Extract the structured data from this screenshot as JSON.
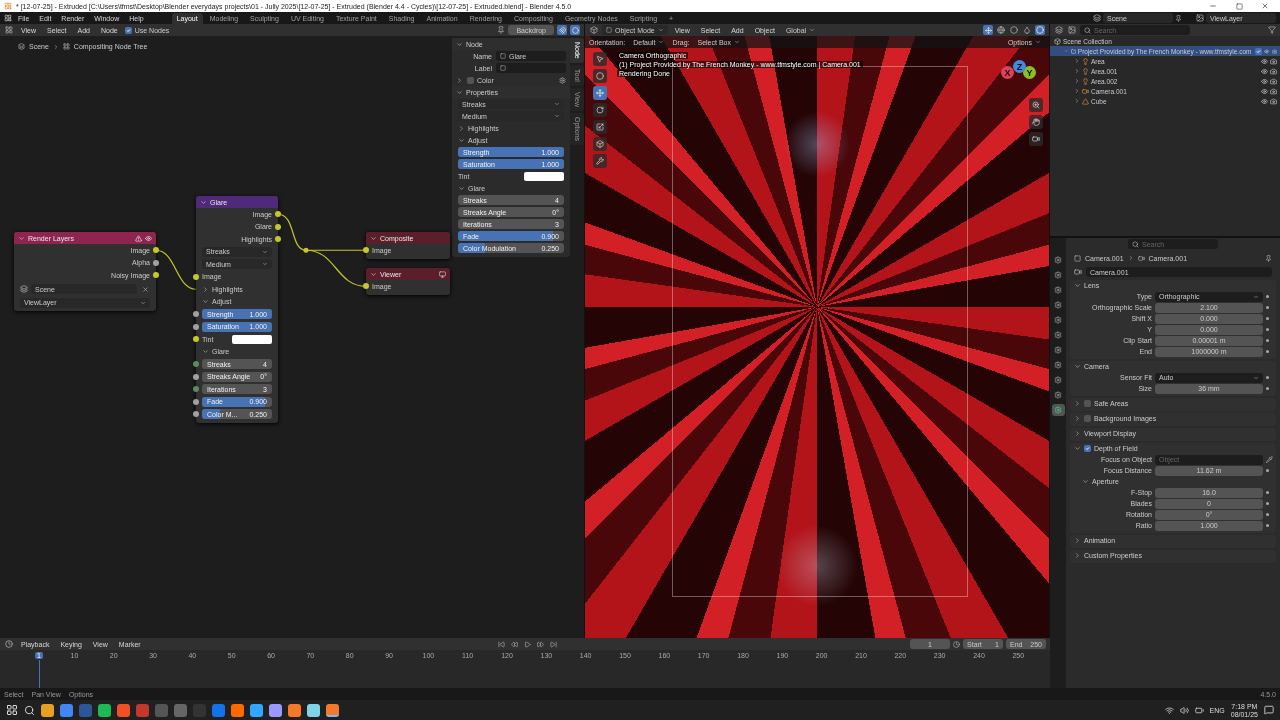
{
  "title_bar": {
    "title": "* [12-07-25] - Extruded [C:\\Users\\tfmst\\Desktop\\Blender everydays projects\\01 - Jully 2025\\[12-07-25] - Extruded (Blender 4.4 - Cycles)\\[12-07-25] - Extruded.blend] - Blender 4.5.0"
  },
  "menu_bar": {
    "menus": [
      "File",
      "Edit",
      "Render",
      "Window",
      "Help"
    ],
    "workspaces": [
      {
        "label": "Layout",
        "selected": true
      },
      {
        "label": "Modeling",
        "selected": false
      },
      {
        "label": "Sculpting",
        "selected": false
      },
      {
        "label": "UV Editing",
        "selected": false
      },
      {
        "label": "Texture Paint",
        "selected": false
      },
      {
        "label": "Shading",
        "selected": false
      },
      {
        "label": "Animation",
        "selected": false
      },
      {
        "label": "Rendering",
        "selected": false
      },
      {
        "label": "Compositing",
        "selected": false
      },
      {
        "label": "Geometry Nodes",
        "selected": false
      },
      {
        "label": "Scripting",
        "selected": false
      }
    ],
    "add_workspace": "+",
    "scene": "Scene",
    "view_layer": "ViewLayer"
  },
  "node_editor": {
    "menus": [
      "View",
      "Select",
      "Add",
      "Node"
    ],
    "use_nodes": {
      "label": "Use Nodes",
      "checked": true
    },
    "backdrop": "Backdrop",
    "breadcrumb": [
      "Scene",
      "Compositing Node Tree"
    ],
    "nodes": [
      {
        "kind": "input",
        "title": "Render Layers",
        "rows": [
          {
            "kind": "output",
            "label": "Image",
            "color": "#c7c729"
          },
          {
            "kind": "output",
            "label": "Alpha",
            "color": "#a1a1a1"
          },
          {
            "kind": "output",
            "label": "Noisy Image",
            "color": "#c7c729"
          },
          {
            "kind": "scene",
            "value": "Scene"
          },
          {
            "kind": "dropdown",
            "value": "ViewLayer"
          }
        ]
      },
      {
        "kind": "filter",
        "title": "Glare",
        "rows": [
          {
            "kind": "output",
            "label": "Image",
            "color": "#c7c729"
          },
          {
            "kind": "output",
            "label": "Glare",
            "color": "#c7c729"
          },
          {
            "kind": "output",
            "label": "Highlights",
            "color": "#c7c729"
          },
          {
            "kind": "dropdown",
            "value": "Streaks"
          },
          {
            "kind": "dropdown",
            "value": "Medium"
          },
          {
            "kind": "input",
            "label": "Image",
            "color": "#c7c729"
          },
          {
            "kind": "panel",
            "label": "Highlights",
            "expanded": false
          },
          {
            "kind": "panel",
            "label": "Adjust",
            "expanded": true
          },
          {
            "kind": "slider",
            "label": "Strength",
            "value": "1.000",
            "level": 1,
            "color": "#a1a1a1"
          },
          {
            "kind": "slider",
            "label": "Saturation",
            "value": "1.000",
            "level": 1,
            "color": "#a1a1a1"
          },
          {
            "kind": "color",
            "label": "Tint",
            "color": "#c7c729"
          },
          {
            "kind": "panel",
            "label": "Glare",
            "expanded": true
          },
          {
            "kind": "number",
            "label": "Streaks",
            "value": "4",
            "color": "#598c5c"
          },
          {
            "kind": "number",
            "label": "Streaks Angle",
            "value": "0°",
            "color": "#a1a1a1"
          },
          {
            "kind": "number",
            "label": "Iterations",
            "value": "3",
            "color": "#598c5c"
          },
          {
            "kind": "slider",
            "label": "Fade",
            "value": "0.900",
            "level": 0.9,
            "color": "#a1a1a1"
          },
          {
            "kind": "slider",
            "label": "Color M...",
            "value": "0.250",
            "level": 0.25,
            "color": "#a1a1a1"
          }
        ]
      },
      {
        "kind": "output",
        "title": "Composite",
        "rows": [
          {
            "kind": "input",
            "label": "Image",
            "color": "#c7c729"
          }
        ]
      },
      {
        "kind": "viewer",
        "title": "Viewer",
        "rows": [
          {
            "kind": "input",
            "label": "Image",
            "color": "#c7c729"
          }
        ]
      }
    ],
    "sidebar": {
      "tabs": [
        {
          "label": "Node",
          "selected": true
        },
        {
          "label": "Tool",
          "selected": false
        },
        {
          "label": "View",
          "selected": false
        },
        {
          "label": "Options",
          "selected": false
        }
      ],
      "node_panel": {
        "title": "Node",
        "name_label": "Name",
        "name": "Glare",
        "label_label": "Label",
        "color_label": "Color",
        "color_checked": false
      },
      "properties_panel": {
        "title": "Properties",
        "rows": [
          {
            "kind": "dropdown",
            "value": "Streaks"
          },
          {
            "kind": "dropdown",
            "value": "Medium"
          },
          {
            "kind": "panel",
            "label": "Highlights",
            "expanded": false
          },
          {
            "kind": "panel",
            "label": "Adjust",
            "expanded": true
          },
          {
            "kind": "slider",
            "label": "Strength",
            "value": "1.000",
            "level": 1
          },
          {
            "kind": "slider",
            "label": "Saturation",
            "value": "1.000",
            "level": 1
          },
          {
            "kind": "color",
            "label": "Tint"
          },
          {
            "kind": "panel",
            "label": "Glare",
            "expanded": true
          },
          {
            "kind": "number",
            "label": "Streaks",
            "value": "4"
          },
          {
            "kind": "number",
            "label": "Streaks Angle",
            "value": "0°"
          },
          {
            "kind": "number",
            "label": "Iterations",
            "value": "3"
          },
          {
            "kind": "slider",
            "label": "Fade",
            "value": "0.900",
            "level": 0.9
          },
          {
            "kind": "slider",
            "label": "Color Modulation",
            "value": "0.250",
            "level": 0.25
          }
        ]
      }
    }
  },
  "viewport": {
    "mode": "Object Mode",
    "menus": [
      "View",
      "Select",
      "Add",
      "Object"
    ],
    "transform": "Global",
    "orientation_label": "Orientation:",
    "orientation": "Default",
    "drag_label": "Drag:",
    "drag": "Select Box",
    "options": "Options",
    "overlay_lines": [
      "Camera Orthographic",
      "(1) Project Provided by The French Monkey - www.tfmstyle.com | Camera.001",
      "Rendering Done"
    ],
    "gizmo": [
      {
        "label": "X",
        "color": "#e0405a"
      },
      {
        "label": "Y",
        "color": "#8bbf26"
      },
      {
        "label": "Z",
        "color": "#3f8be0"
      }
    ]
  },
  "outliner": {
    "search_placeholder": "Search",
    "tree": [
      {
        "label": "Scene Collection",
        "kind": "scene",
        "selected": false,
        "children": [
          {
            "label": "Project Provided by The French Monkey - www.tfmstyle.com",
            "kind": "collection",
            "expanded": true,
            "selected": true,
            "children": [
              {
                "label": "Area",
                "kind": "light",
                "expanded": false,
                "selected": false
              },
              {
                "label": "Area.001",
                "kind": "light",
                "expanded": false,
                "selected": false
              },
              {
                "label": "Area.002",
                "kind": "light",
                "expanded": false,
                "selected": false
              },
              {
                "label": "Camera.001",
                "kind": "camera",
                "expanded": false,
                "selected": false
              },
              {
                "label": "Cube",
                "kind": "mesh",
                "expanded": false,
                "selected": false
              }
            ]
          }
        ]
      }
    ]
  },
  "properties": {
    "search_placeholder": "Search",
    "tabs": [
      {
        "selected": false
      },
      {
        "selected": false
      },
      {
        "selected": false
      },
      {
        "selected": false
      },
      {
        "selected": false
      },
      {
        "selected": false
      },
      {
        "selected": false
      },
      {
        "selected": false
      },
      {
        "selected": false
      },
      {
        "selected": false
      },
      {
        "selected": true
      }
    ],
    "breadcrumb": [
      "Camera.001",
      "Camera.001"
    ],
    "data_name": "Camera.001",
    "panels": [
      {
        "title": "Lens",
        "expanded": true,
        "rows": [
          {
            "kind": "dropdown",
            "label": "Type",
            "value": "Orthographic"
          },
          {
            "kind": "number",
            "label": "Orthographic Scale",
            "value": "2.100"
          },
          {
            "kind": "number",
            "label": "Shift X",
            "value": "0.000"
          },
          {
            "kind": "number",
            "label": "Y",
            "value": "0.000"
          },
          {
            "kind": "number",
            "label": "Clip Start",
            "value": "0.00001 m"
          },
          {
            "kind": "number",
            "label": "End",
            "value": "1000000 m"
          }
        ]
      },
      {
        "title": "Camera",
        "expanded": true,
        "rows": [
          {
            "kind": "dropdown",
            "label": "Sensor Fit",
            "value": "Auto"
          },
          {
            "kind": "number",
            "label": "Size",
            "value": "36 mm"
          }
        ]
      },
      {
        "title": "Safe Areas",
        "expanded": false,
        "checkbox": false
      },
      {
        "title": "Background Images",
        "expanded": false,
        "checkbox": false
      },
      {
        "title": "Viewport Display",
        "expanded": false
      },
      {
        "title": "Depth of Field",
        "expanded": true,
        "checkbox": true,
        "rows": [
          {
            "kind": "object",
            "label": "Focus on Object",
            "placeholder": "Object"
          },
          {
            "kind": "number",
            "label": "Focus Distance",
            "value": "11.62 m"
          },
          {
            "kind": "subpanel",
            "label": "Aperture",
            "expanded": true
          },
          {
            "kind": "number",
            "label": "F-Stop",
            "value": "16.0"
          },
          {
            "kind": "number",
            "label": "Blades",
            "value": "0"
          },
          {
            "kind": "number",
            "label": "Rotation",
            "value": "0°"
          },
          {
            "kind": "number",
            "label": "Ratio",
            "value": "1.000"
          }
        ]
      },
      {
        "title": "Animation",
        "expanded": false
      },
      {
        "title": "Custom Properties",
        "expanded": false
      }
    ]
  },
  "timeline": {
    "menus": [
      "Playback",
      "Keying",
      "View",
      "Marker"
    ],
    "current_frame": "1",
    "start_label": "Start",
    "start": "1",
    "end_label": "End",
    "end": "250",
    "ruler": [
      {
        "label": "1",
        "selected": true
      },
      {
        "label": "10",
        "selected": false
      },
      {
        "label": "20",
        "selected": false
      },
      {
        "label": "30",
        "selected": false
      },
      {
        "label": "40",
        "selected": false
      },
      {
        "label": "50",
        "selected": false
      },
      {
        "label": "60",
        "selected": false
      },
      {
        "label": "70",
        "selected": false
      },
      {
        "label": "80",
        "selected": false
      },
      {
        "label": "90",
        "selected": false
      },
      {
        "label": "100",
        "selected": false
      },
      {
        "label": "110",
        "selected": false
      },
      {
        "label": "120",
        "selected": false
      },
      {
        "label": "130",
        "selected": false
      },
      {
        "label": "140",
        "selected": false
      },
      {
        "label": "150",
        "selected": false
      },
      {
        "label": "160",
        "selected": false
      },
      {
        "label": "170",
        "selected": false
      },
      {
        "label": "180",
        "selected": false
      },
      {
        "label": "190",
        "selected": false
      },
      {
        "label": "200",
        "selected": false
      },
      {
        "label": "210",
        "selected": false
      },
      {
        "label": "220",
        "selected": false
      },
      {
        "label": "230",
        "selected": false
      },
      {
        "label": "240",
        "selected": false
      },
      {
        "label": "250",
        "selected": false
      }
    ]
  },
  "status_bar": {
    "items": [
      "Select",
      "Pan View",
      "Options"
    ],
    "version": "4.5.0"
  },
  "taskbar": {
    "language": "ENG",
    "time": "7:18 PM",
    "date": "08/01/25"
  }
}
